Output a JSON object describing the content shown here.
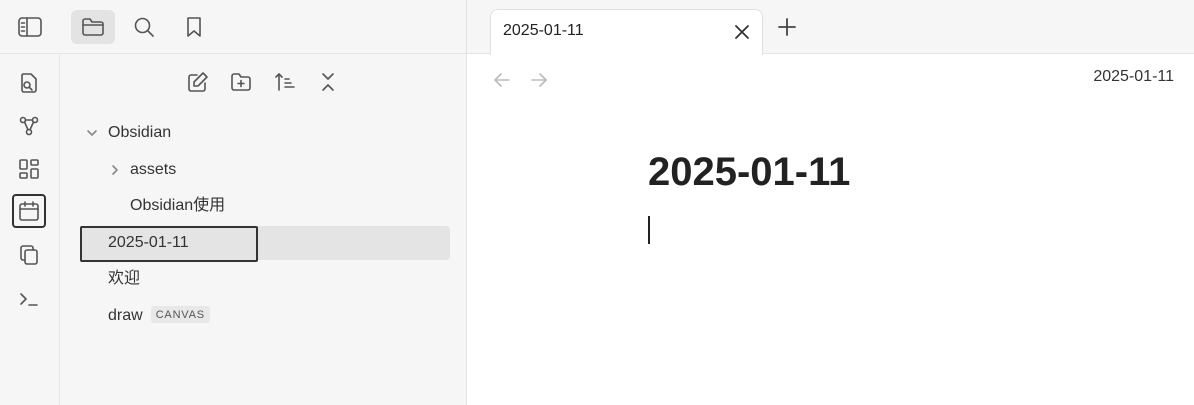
{
  "toolbar": {
    "icons": [
      "sidebar-toggle-icon",
      "folder-icon",
      "search-icon",
      "bookmark-icon"
    ],
    "active": "folder-icon"
  },
  "ribbon": {
    "icons": [
      "quick-switcher-icon",
      "graph-view-icon",
      "dashboard-icon",
      "calendar-icon",
      "copy-icon",
      "terminal-icon"
    ],
    "active": "calendar-icon"
  },
  "file_explorer": {
    "actions": [
      "new-note-icon",
      "new-folder-icon",
      "sort-icon",
      "collapse-all-icon"
    ],
    "tree": {
      "root": "Obsidian",
      "assets": "assets",
      "obsidian_usage": "Obsidian使用",
      "selected": "2025-01-11",
      "welcome": "欢迎",
      "draw": "draw",
      "draw_badge": "CANVAS"
    }
  },
  "tabs": [
    {
      "title": "2025-01-11",
      "active": true
    }
  ],
  "editor": {
    "header_title": "2025-01-11",
    "note_title": "2025-01-11"
  },
  "colors": {
    "sidebar_bg": "#f6f6f6",
    "selected_bg": "#e4e4e4",
    "text": "#222222"
  }
}
